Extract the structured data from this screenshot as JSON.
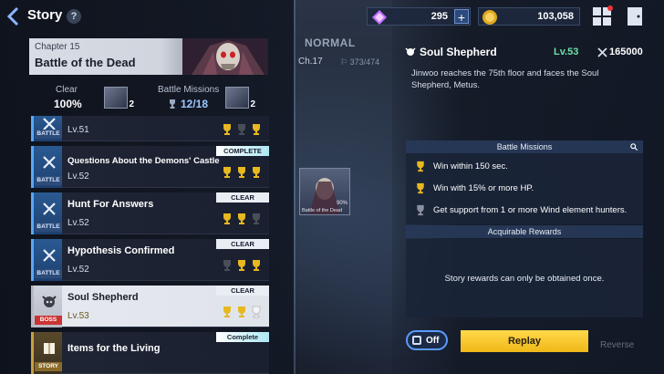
{
  "header": {
    "title": "Story",
    "help": "?"
  },
  "chapter": {
    "number": "Chapter 15",
    "name": "Battle of the Dead",
    "clear_label": "Clear",
    "clear_value": "100%",
    "clear_icon_count": "2",
    "missions_label": "Battle Missions",
    "missions_value": "12/18",
    "missions_icon_count": "2"
  },
  "stages": [
    {
      "name": "",
      "level": "Lv.51",
      "badge": "BATTLE",
      "status": "",
      "trophies": [
        "gold",
        "dark",
        "gold"
      ]
    },
    {
      "name": "Questions About the Demons' Castle",
      "level": "Lv.52",
      "badge": "BATTLE",
      "status": "COMPLETE",
      "trophies": [
        "gold",
        "gold",
        "gold"
      ]
    },
    {
      "name": "Hunt For Answers",
      "level": "Lv.52",
      "badge": "BATTLE",
      "status": "CLEAR",
      "trophies": [
        "gold",
        "gold",
        "dark"
      ]
    },
    {
      "name": "Hypothesis Confirmed",
      "level": "Lv.52",
      "badge": "BATTLE",
      "status": "CLEAR",
      "trophies": [
        "dark",
        "gold",
        "gold"
      ]
    },
    {
      "name": "Soul Shepherd",
      "level": "Lv.53",
      "badge": "BOSS",
      "status": "CLEAR",
      "trophies": [
        "gold",
        "gold",
        "empty"
      ]
    },
    {
      "name": "Items for the Living",
      "level": "",
      "badge": "STORY",
      "status": "Complete",
      "trophies": []
    }
  ],
  "center": {
    "difficulty": "NORMAL",
    "chapter": "Ch.17",
    "progress": "373/474",
    "thumb_pct": "90%",
    "thumb_label": "Battle of the Dead"
  },
  "topbar": {
    "gems": "295",
    "gold": "103,058",
    "plus": "+"
  },
  "boss": {
    "title": "Soul Shepherd",
    "level": "Lv.53",
    "power": "165000",
    "description": "Jinwoo reaches the 75th floor and faces the Soul Shepherd, Metus."
  },
  "missions": {
    "header": "Battle Missions",
    "items": [
      {
        "text": "Win within 150 sec.",
        "achieved": true
      },
      {
        "text": "Win with 15% or more HP.",
        "achieved": true
      },
      {
        "text": "Get support from 1 or more Wind element hunters.",
        "achieved": false
      }
    ]
  },
  "rewards": {
    "header": "Acquirable Rewards",
    "text": "Story rewards can only be obtained once."
  },
  "footer": {
    "toggle_label": "Off",
    "replay_label": "Replay",
    "reverse_label": "Reverse"
  },
  "colors": {
    "accent_blue": "#56a8ff",
    "replay_yellow": "#f0b818",
    "level_green": "#6ee0a8",
    "boss_red": "#cc3333"
  }
}
